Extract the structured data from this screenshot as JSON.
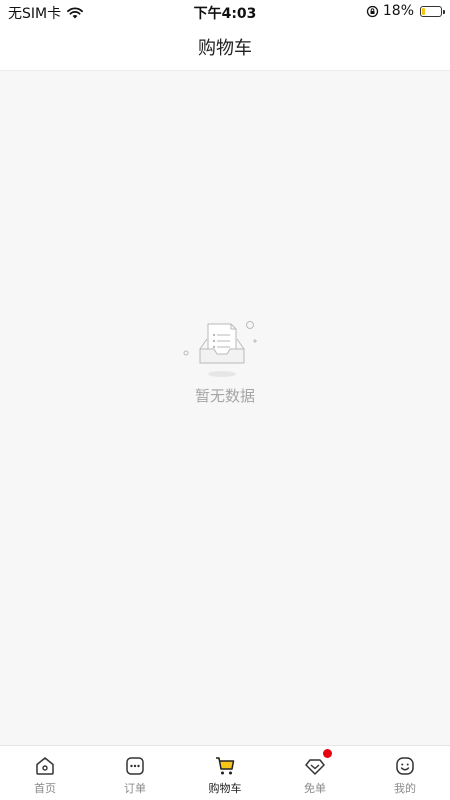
{
  "status_bar": {
    "carrier": "无SIM卡",
    "time": "下午4:03",
    "battery_percent_text": "18%",
    "battery_level": 0.18
  },
  "nav": {
    "title": "购物车"
  },
  "empty_state": {
    "message": "暂无数据",
    "illustration": "empty-inbox-icon"
  },
  "tab_bar": {
    "tabs": [
      {
        "label": "首页",
        "icon": "home-icon",
        "active": false
      },
      {
        "label": "订单",
        "icon": "order-icon",
        "active": false
      },
      {
        "label": "购物车",
        "icon": "cart-icon",
        "active": true
      },
      {
        "label": "免单",
        "icon": "coupon-icon",
        "active": false,
        "badge": true
      },
      {
        "label": "我的",
        "icon": "profile-icon",
        "active": false
      }
    ]
  },
  "colors": {
    "accent": "#f5c518",
    "badge": "#e60012",
    "background": "#f7f7f7"
  }
}
